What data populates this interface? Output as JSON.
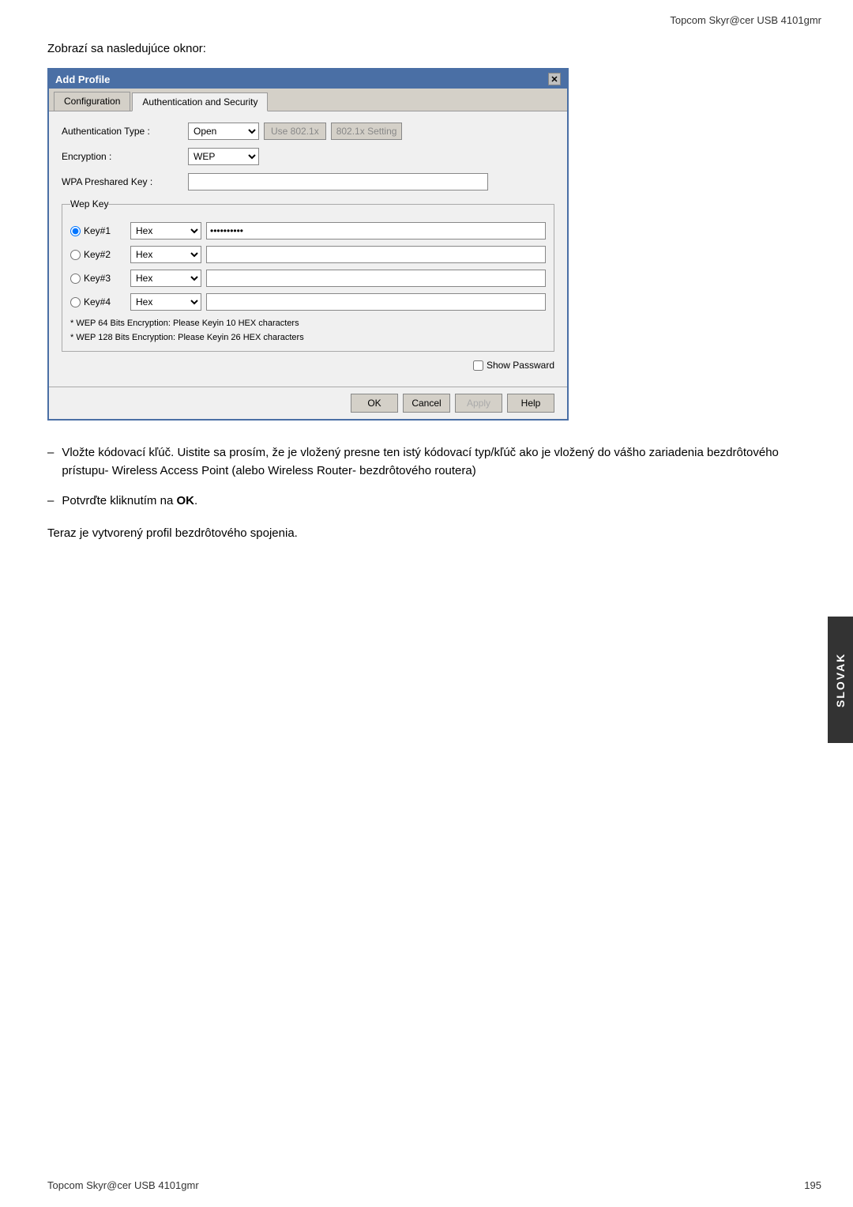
{
  "header": {
    "title": "Topcom Skyr@cer USB 4101gmr"
  },
  "intro": {
    "text": "Zobrazí sa nasledujúce oknor:"
  },
  "dialog": {
    "title": "Add Profile",
    "tabs": [
      {
        "label": "Configuration",
        "active": false
      },
      {
        "label": "Authentication and Security",
        "active": true
      }
    ],
    "auth_type_label": "Authentication Type :",
    "auth_type_value": "Open",
    "use_8021x_label": "Use 802.1x",
    "setting_8021x_label": "802.1x Setting",
    "encryption_label": "Encryption :",
    "encryption_value": "WEP",
    "wpa_label": "WPA Preshared Key :",
    "wep_key_group_label": "Wep Key",
    "keys": [
      {
        "id": "Key#1",
        "type": "Hex",
        "value": "xxxxxxxxxx",
        "selected": true
      },
      {
        "id": "Key#2",
        "type": "Hex",
        "value": "",
        "selected": false
      },
      {
        "id": "Key#3",
        "type": "Hex",
        "value": "",
        "selected": false
      },
      {
        "id": "Key#4",
        "type": "Hex",
        "value": "",
        "selected": false
      }
    ],
    "notes": [
      "* WEP 64 Bits Encryption:   Please Keyin 10 HEX characters",
      "* WEP 128 Bits Encryption:   Please Keyin 26 HEX characters"
    ],
    "show_password_label": "Show Passward",
    "buttons": {
      "ok": "OK",
      "cancel": "Cancel",
      "apply": "Apply",
      "help": "Help"
    }
  },
  "bullets": [
    {
      "dash": "–",
      "text": "Vložte kódovací kľúč. Uistite sa prosím, že je vložený presne ten istý kódovací typ/kľúč ako je vložený do vášho zariadenia bezdrôtového prístupu- Wireless Access Point (alebo Wireless Router- bezdrôtového routera)"
    },
    {
      "dash": "–",
      "text_prefix": "Potvrďte kliknutím na ",
      "text_bold": "OK",
      "text_suffix": "."
    }
  ],
  "conclusion": {
    "text": "Teraz je vytvorený profil bezdrôtového spojenia."
  },
  "side_label": "SLOVAK",
  "footer": {
    "left": "Topcom Skyr@cer USB 4101gmr",
    "right": "195"
  }
}
